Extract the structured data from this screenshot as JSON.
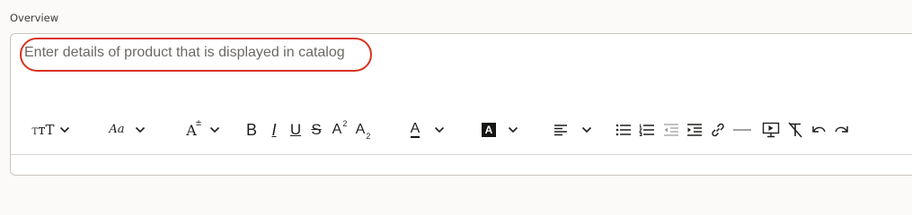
{
  "overview": {
    "label": "Overview",
    "placeholder": "Enter details of product that is displayed in catalog"
  },
  "toolbar": {
    "icons": [
      "font-style-icon",
      "chevron-down-icon",
      "font-family-icon",
      "chevron-down-icon",
      "font-size-icon",
      "chevron-down-icon",
      "bold-icon",
      "italic-icon",
      "underline-icon",
      "strikethrough-icon",
      "superscript-icon",
      "subscript-icon",
      "text-color-icon",
      "chevron-down-icon",
      "highlight-color-icon",
      "chevron-down-icon",
      "align-icon",
      "chevron-down-icon",
      "bulleted-list-icon",
      "numbered-list-icon",
      "outdent-icon",
      "indent-icon",
      "link-icon",
      "horizontal-rule-icon",
      "insert-media-icon",
      "clear-formatting-icon",
      "undo-icon",
      "redo-icon"
    ],
    "glyphs": {
      "bold": "B",
      "italic": "I",
      "underline": "U",
      "strike": "S",
      "fontstyle": "тT",
      "fontfamily": "Aa",
      "fontsize": "A",
      "super": "A",
      "sub": "A",
      "textcolor": "A",
      "highlight": "A"
    }
  },
  "colors": {
    "highlight_oval": "#d8321e",
    "border": "#c9c6c1",
    "placeholder": "#6b6964"
  }
}
